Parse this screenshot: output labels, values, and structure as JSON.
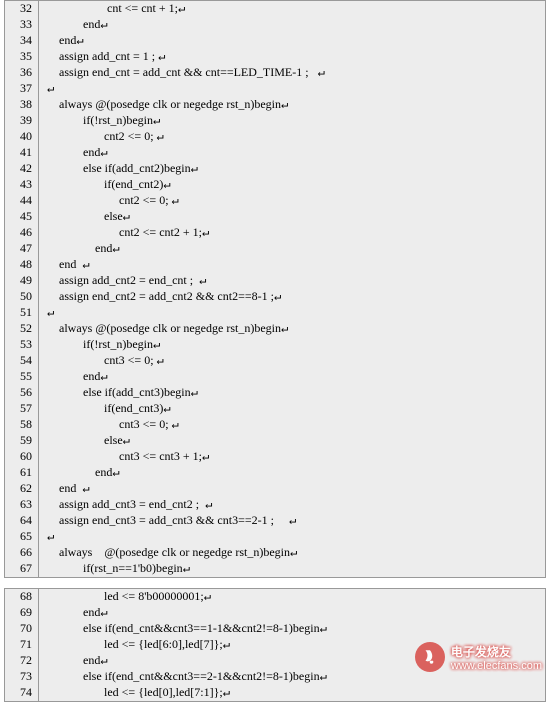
{
  "watermark": {
    "title": "电子发烧友",
    "url": "www.elecfans.com"
  },
  "blocks": [
    {
      "start": 32,
      "lines": [
        "                    cnt <= cnt + 1;↩",
        "            end↩",
        "    end↩",
        "    assign add_cnt = 1 ; ↩",
        "    assign end_cnt = add_cnt && cnt==LED_TIME-1 ;   ↩",
        "↩",
        "    always @(posedge clk or negedge rst_n)begin↩",
        "            if(!rst_n)begin↩",
        "                   cnt2 <= 0; ↩",
        "            end↩",
        "            else if(add_cnt2)begin↩",
        "                   if(end_cnt2)↩",
        "                        cnt2 <= 0; ↩",
        "                   else↩",
        "                        cnt2 <= cnt2 + 1;↩",
        "                end↩",
        "    end  ↩",
        "    assign add_cnt2 = end_cnt ;  ↩",
        "    assign end_cnt2 = add_cnt2 && cnt2==8-1 ;↩",
        "↩",
        "    always @(posedge clk or negedge rst_n)begin↩",
        "            if(!rst_n)begin↩",
        "                   cnt3 <= 0; ↩",
        "            end↩",
        "            else if(add_cnt3)begin↩",
        "                   if(end_cnt3)↩",
        "                        cnt3 <= 0; ↩",
        "                   else↩",
        "                        cnt3 <= cnt3 + 1;↩",
        "                end↩",
        "    end  ↩",
        "    assign add_cnt3 = end_cnt2 ;  ↩",
        "    assign end_cnt3 = add_cnt3 && cnt3==2-1 ;     ↩",
        "↩",
        "    always    @(posedge clk or negedge rst_n)begin↩",
        "            if(rst_n==1'b0)begin↩"
      ]
    },
    {
      "start": 68,
      "lines": [
        "                   led <= 8'b00000001;↩",
        "            end↩",
        "            else if(end_cnt&&cnt3==1-1&&cnt2!=8-1)begin↩",
        "                   led <= {led[6:0],led[7]};↩",
        "            end↩",
        "            else if(end_cnt&&cnt3==2-1&&cnt2!=8-1)begin↩",
        "                   led <= {led[0],led[7:1]};↩"
      ]
    }
  ]
}
